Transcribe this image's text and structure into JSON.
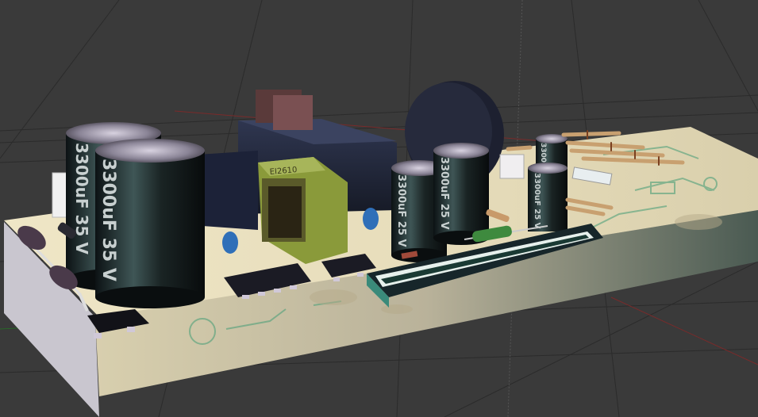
{
  "scene": {
    "background_color": "#3a3a3a",
    "grid_color": "#2b2b2b",
    "axis_x_color": "#8a2a2a",
    "axis_y_color": "#2a6a2a",
    "board_color": "#e8dfc0",
    "board_edge_color": "#c9c6cf"
  },
  "components": {
    "large_capacitor_label_1": "3300uF 35 V",
    "large_capacitor_label_2": "3300uF 35 V",
    "mid_capacitor_label_1": "3300uF 25 V",
    "mid_capacitor_label_2": "3300uF 25 V",
    "small_capacitor_label_1": "3300uF 25 V",
    "small_capacitor_label_2": "3300uF 25 V",
    "transformer_label": "EI2610"
  }
}
